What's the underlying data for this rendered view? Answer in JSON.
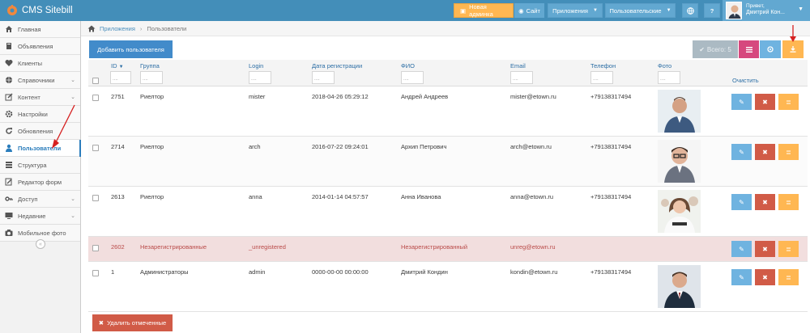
{
  "app": {
    "title": "CMS Sitebill"
  },
  "topnav": {
    "new_admin": "Новая админка",
    "site": "Сайт",
    "apps": "Приложения",
    "user_apps": "Пользовательские",
    "user_hello": "Привет,",
    "user_name": "Дмитрий Кон..."
  },
  "sidebar": {
    "items": [
      {
        "label": "Главная",
        "icon": "home-icon"
      },
      {
        "label": "Объявления",
        "icon": "book-icon"
      },
      {
        "label": "Клиенты",
        "icon": "heart-icon"
      },
      {
        "label": "Справочники",
        "icon": "globe-icon"
      },
      {
        "label": "Контент",
        "icon": "edit-icon"
      },
      {
        "label": "Настройки",
        "icon": "gear-icon"
      },
      {
        "label": "Обновления",
        "icon": "refresh-icon"
      },
      {
        "label": "Пользователи",
        "icon": "user-icon"
      },
      {
        "label": "Структура",
        "icon": "list-icon"
      },
      {
        "label": "Редактор форм",
        "icon": "form-icon"
      },
      {
        "label": "Доступ",
        "icon": "key-icon"
      },
      {
        "label": "Недавние",
        "icon": "desktop-icon"
      },
      {
        "label": "Мобильное фото",
        "icon": "camera-icon"
      }
    ]
  },
  "breadcrumb": {
    "root": "Приложения",
    "current": "Пользователи"
  },
  "toolbar": {
    "add_user": "Добавить пользователя",
    "all_label": "Всего: 5"
  },
  "table": {
    "columns": [
      "ID",
      "Группа",
      "Login",
      "Дата регистрации",
      "ФИО",
      "Email",
      "Телефон",
      "Фото"
    ],
    "clear_label": "Очистить",
    "rows": [
      {
        "id": "2751",
        "group": "Риелтор",
        "login": "mister",
        "date": "2018-04-26 05:29:12",
        "fio": "Андрей Андреев",
        "email": "mister@etown.ru",
        "phone": "+79138317494"
      },
      {
        "id": "2714",
        "group": "Риелтор",
        "login": "arch",
        "date": "2016-07-22 09:24:01",
        "fio": "Архип Петрович",
        "email": "arch@etown.ru",
        "phone": "+79138317494"
      },
      {
        "id": "2613",
        "group": "Риелтор",
        "login": "anna",
        "date": "2014-01-14 04:57:57",
        "fio": "Анна Иванова",
        "email": "anna@etown.ru",
        "phone": "+79138317494"
      },
      {
        "id": "2602",
        "group": "Незарегистрированные",
        "login": "_unregistered",
        "date": "",
        "fio": "Незарегистрированный",
        "email": "unreg@etown.ru",
        "phone": ""
      },
      {
        "id": "1",
        "group": "Администраторы",
        "login": "admin",
        "date": "0000-00-00 00:00:00",
        "fio": "Дмитрий Кондин",
        "email": "kondin@etown.ru",
        "phone": "+79138317494"
      }
    ]
  },
  "footer": {
    "delete_selected": "Удалить отмеченные"
  },
  "colors": {
    "navbar": "#438eb9",
    "primary": "#428bca",
    "danger": "#d15b47",
    "warning": "#ffb752",
    "pink": "#d6487e",
    "info": "#6fb3e0",
    "unregistered_row": "#f2dede"
  }
}
